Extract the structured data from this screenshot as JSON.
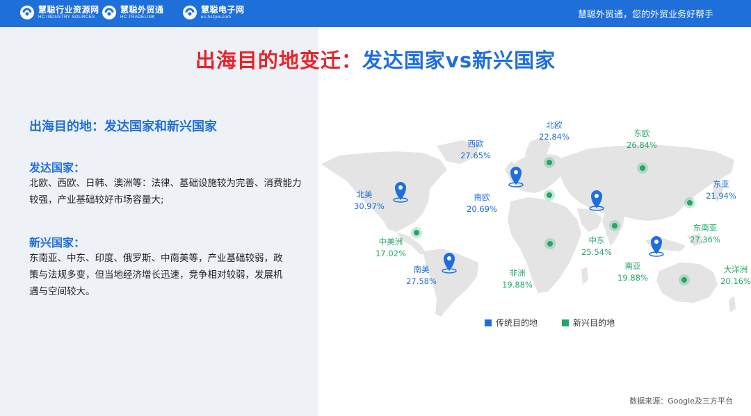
{
  "header": {
    "logos": [
      {
        "name": "慧聪行业资源网",
        "sub": "HC INDUSTRY SOURCES"
      },
      {
        "name": "慧聪外贸通",
        "sub": "HC TRADELINK"
      },
      {
        "name": "慧聪电子网",
        "sub": "ec.hczyw.com"
      }
    ],
    "slogan": "慧聪外贸通，您的外贸业务好帮手"
  },
  "title": {
    "part1": "出海目的地变迁：",
    "part2": "发达国家vs新兴国家"
  },
  "left": {
    "section_title": "出海目的地：发达国家和新兴国家",
    "developed_heading": "发达国家：",
    "developed_text": "北欧、西欧、日韩、澳洲等：法律、基础设施较为完善、消费能力较强，产业基础较好市场容量大;",
    "emerging_heading": "新兴国家：",
    "emerging_text": "东南亚、中东、印度、俄罗斯、中南美等，产业基础较弱，政策与法规多变，但当地经济增长迅速，竞争相对较弱，发展机遇与空间较大。"
  },
  "map": {
    "colors": {
      "traditional": "#1f6fdb",
      "emerging": "#21a866",
      "land": "#e4e4e4"
    },
    "regions": [
      {
        "id": "north-america",
        "name": "北美",
        "value": "30.97%",
        "type": "traditional"
      },
      {
        "id": "west-europe",
        "name": "西欧",
        "value": "27.65%",
        "type": "traditional"
      },
      {
        "id": "north-europe",
        "name": "北欧",
        "value": "22.84%",
        "type": "traditional"
      },
      {
        "id": "east-europe",
        "name": "东欧",
        "value": "26.84%",
        "type": "emerging"
      },
      {
        "id": "east-asia",
        "name": "东亚",
        "value": "21.94%",
        "type": "traditional"
      },
      {
        "id": "south-europe",
        "name": "南欧",
        "value": "20.69%",
        "type": "traditional"
      },
      {
        "id": "central-america",
        "name": "中美洲",
        "value": "17.02%",
        "type": "emerging"
      },
      {
        "id": "southeast-asia",
        "name": "东南亚",
        "value": "27.36%",
        "type": "emerging"
      },
      {
        "id": "middle-east",
        "name": "中东",
        "value": "25.54%",
        "type": "emerging"
      },
      {
        "id": "south-america",
        "name": "南美",
        "value": "27.58%",
        "type": "traditional"
      },
      {
        "id": "africa",
        "name": "非洲",
        "value": "19.88%",
        "type": "emerging"
      },
      {
        "id": "south-asia",
        "name": "南亚",
        "value": "19.88%",
        "type": "emerging"
      },
      {
        "id": "oceania",
        "name": "大洋洲",
        "value": "20.16%",
        "type": "traditional"
      }
    ],
    "legend": {
      "traditional": "传统目的地",
      "emerging": "新兴目的地"
    }
  },
  "source": "数据来源：Google及三方平台"
}
